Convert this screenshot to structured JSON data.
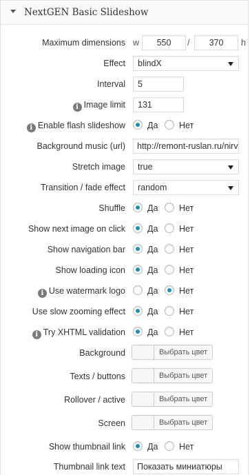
{
  "panel": {
    "title": "NextGEN Basic Slideshow"
  },
  "rows": {
    "max_dimensions": {
      "label": "Maximum dimensions",
      "w_prefix": "w",
      "width": "550",
      "slash": "/",
      "height": "370",
      "h_suffix": "h"
    },
    "effect": {
      "label": "Effect",
      "value": "blindX"
    },
    "interval": {
      "label": "Interval",
      "value": "5"
    },
    "image_limit": {
      "label": "Image limit",
      "value": "131",
      "info_icon": "info-icon"
    },
    "flash_slideshow": {
      "label": "Enable flash slideshow",
      "yes": "Да",
      "no": "Нет",
      "selected": "yes",
      "info_icon": "info-icon"
    },
    "background_music": {
      "label": "Background music (url)",
      "value": "http://remont-ruslan.ru/nirv"
    },
    "stretch_image": {
      "label": "Stretch image",
      "value": "true"
    },
    "transition": {
      "label": "Transition / fade effect",
      "value": "random"
    },
    "shuffle": {
      "label": "Shuffle",
      "yes": "Да",
      "no": "Нет",
      "selected": "yes"
    },
    "show_next_on_click": {
      "label": "Show next image on click",
      "yes": "Да",
      "no": "Нет",
      "selected": "yes"
    },
    "show_nav_bar": {
      "label": "Show navigation bar",
      "yes": "Да",
      "no": "Нет",
      "selected": "yes"
    },
    "show_loading_icon": {
      "label": "Show loading icon",
      "yes": "Да",
      "no": "Нет",
      "selected": "yes"
    },
    "use_watermark": {
      "label": "Use watermark logo",
      "yes": "Да",
      "no": "Нет",
      "selected": "no",
      "info_icon": "info-icon"
    },
    "slow_zoom": {
      "label": "Use slow zooming effect",
      "yes": "Да",
      "no": "Нет",
      "selected": "yes"
    },
    "xhtml_validation": {
      "label": "Try XHTML validation",
      "yes": "Да",
      "no": "Нет",
      "selected": "yes",
      "info_icon": "info-icon"
    },
    "background_color": {
      "label": "Background",
      "button": "Выбрать цвет"
    },
    "texts_buttons_color": {
      "label": "Texts / buttons",
      "button": "Выбрать цвет"
    },
    "rollover_color": {
      "label": "Rollover / active",
      "button": "Выбрать цвет"
    },
    "screen_color": {
      "label": "Screen",
      "button": "Выбрать цвет"
    },
    "show_thumbnail_link": {
      "label": "Show thumbnail link",
      "yes": "Да",
      "no": "Нет",
      "selected": "yes"
    },
    "thumbnail_link_text": {
      "label": "Thumbnail link text",
      "value": "Показать миниатюры"
    }
  },
  "colors": {
    "accent": "#1e8cbe"
  }
}
